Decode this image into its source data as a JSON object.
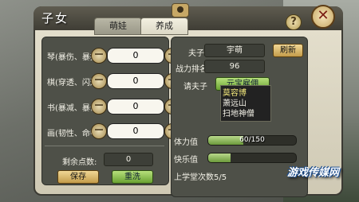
{
  "window": {
    "title": "子女"
  },
  "tabs": [
    {
      "label": "萌娃"
    },
    {
      "label": "养成"
    }
  ],
  "attributes": [
    {
      "label": "琴(暴伤、暴抗):",
      "value": "0"
    },
    {
      "label": "棋(穿透、闪避):",
      "value": "0"
    },
    {
      "label": "书(暴减、暴击):",
      "value": "0"
    },
    {
      "label": "画(韧性、命中):",
      "value": "0"
    }
  ],
  "stepper": {
    "minus": "－",
    "plus": "＋"
  },
  "points": {
    "label": "剩余点数:",
    "value": "0"
  },
  "actions": {
    "save": "保存",
    "reset": "重洗"
  },
  "info": {
    "master_label": "夫子:",
    "master_value": "宇萌",
    "refresh_label": "刷新",
    "rank_label": "战力排名:",
    "rank_value": "96",
    "invite_label": "请夫子",
    "invite_selected": "元宝雇佣"
  },
  "dropdown": {
    "options": [
      "莫容博",
      "萧远山",
      "扫地神僧"
    ]
  },
  "stats": {
    "stamina_label": "体力值",
    "stamina_text": "60/150",
    "stamina_fraction": 0.4,
    "joy_label": "快乐值",
    "school_label": "上学堂次数5/5"
  },
  "watermark": "游戏传媒网",
  "icons": {
    "camera": "camera-icon",
    "help": "help-icon",
    "close": "close-icon"
  },
  "colors": {
    "accent_gold": "#c49c4a",
    "accent_green": "#6aa332",
    "panel": "#4e5048"
  }
}
